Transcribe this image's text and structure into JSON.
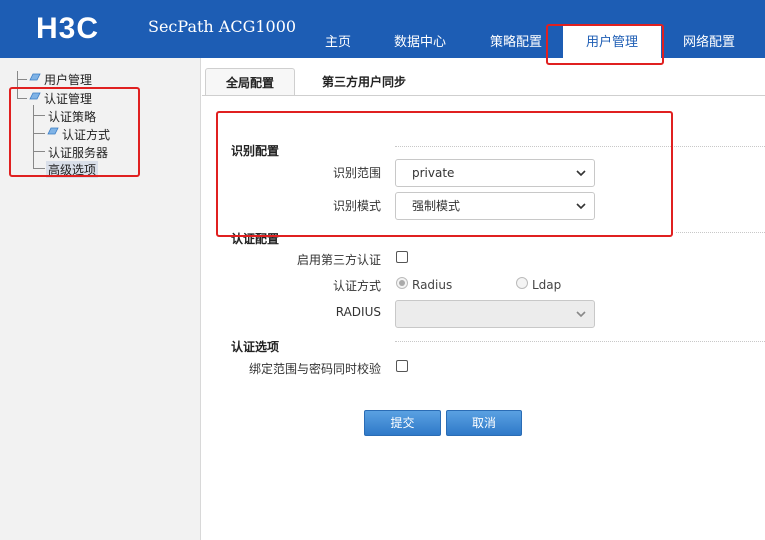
{
  "header": {
    "logo": "H3C",
    "product": "SecPath ACG1000",
    "nav": [
      "主页",
      "数据中心",
      "策略配置",
      "用户管理",
      "网络配置"
    ],
    "active_nav": 3
  },
  "sidebar": {
    "user_mgmt": "用户管理",
    "auth_mgmt": "认证管理",
    "auth_policy": "认证策略",
    "auth_method": "认证方式",
    "auth_server": "认证服务器",
    "advanced": "高级选项"
  },
  "tabs": [
    "全局配置",
    "第三方用户同步"
  ],
  "identify": {
    "title": "识别配置",
    "scope_label": "识别范围",
    "scope_value": "private",
    "mode_label": "识别模式",
    "mode_value": "强制模式"
  },
  "auth": {
    "title": "认证配置",
    "enable_third_label": "启用第三方认证",
    "method_label": "认证方式",
    "radius_option": "Radius",
    "ldap_option": "Ldap",
    "radius_label": "RADIUS",
    "radius_value": ""
  },
  "options": {
    "title": "认证选项",
    "bind_label": "绑定范围与密码同时校验"
  },
  "buttons": {
    "submit": "提交",
    "cancel": "取消"
  },
  "colors": {
    "header_bg": "#1d5db4",
    "highlight": "#e02020",
    "button": "#3a85d2"
  }
}
